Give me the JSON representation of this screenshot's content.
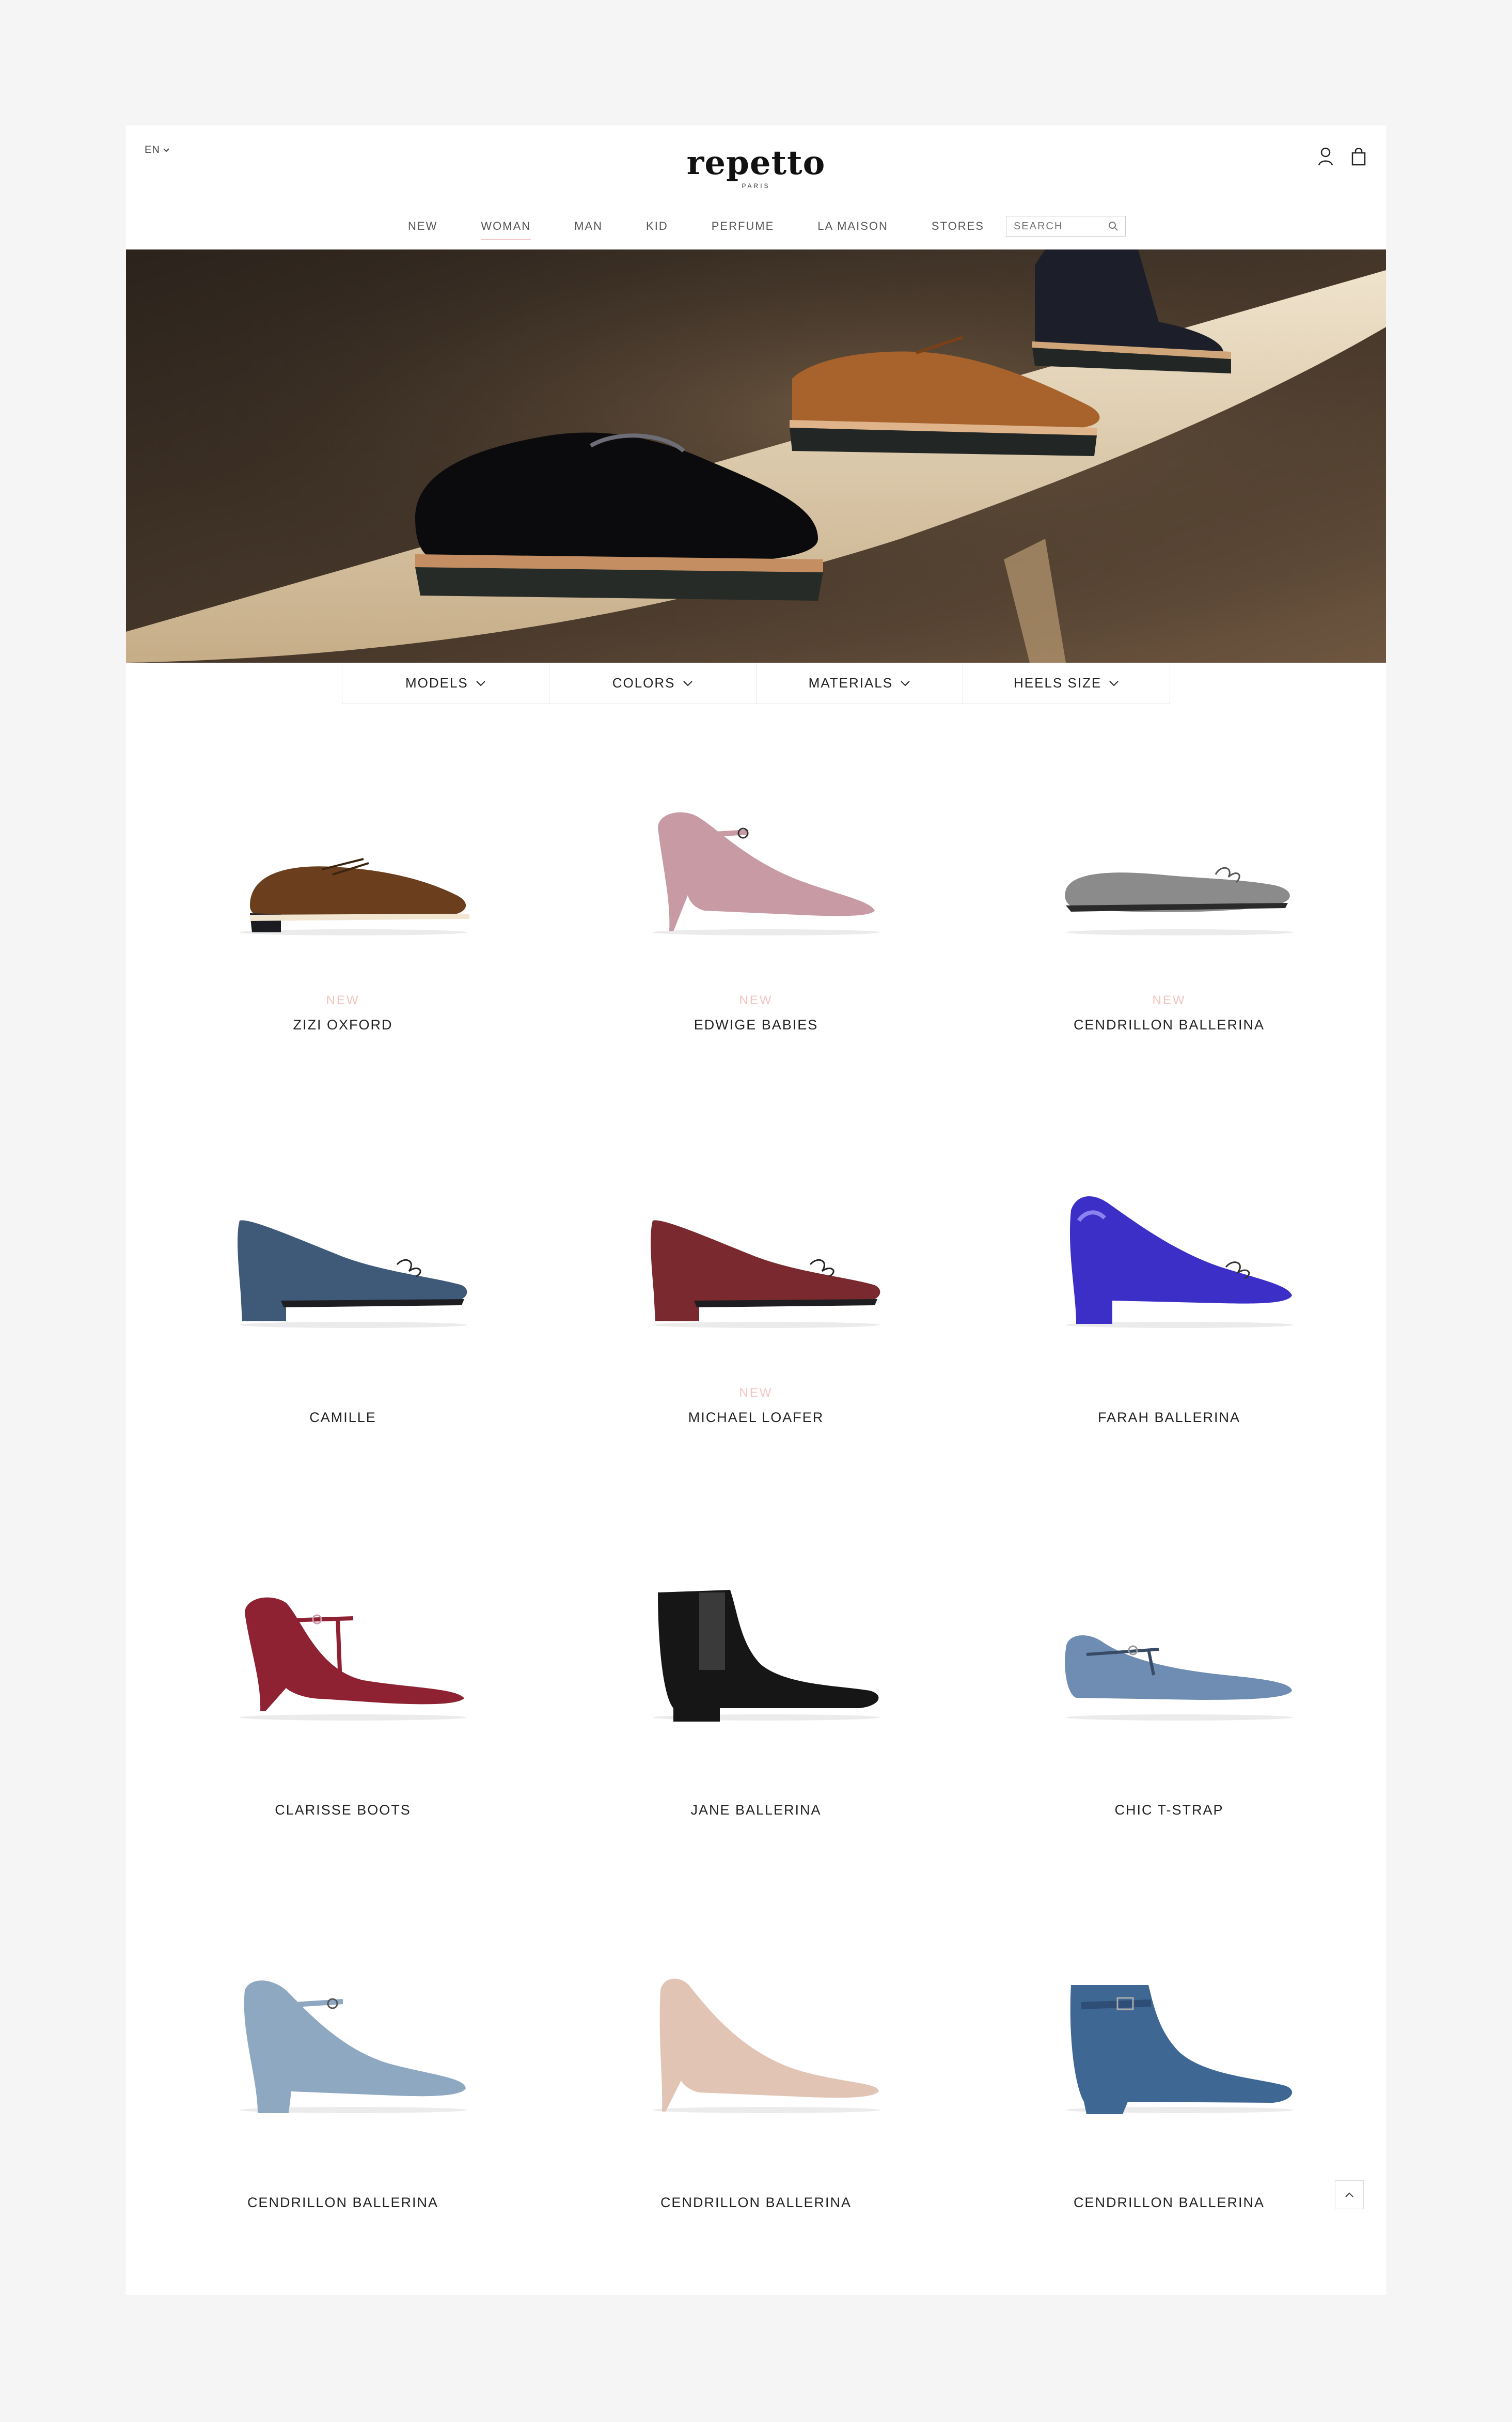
{
  "header": {
    "language": "EN",
    "logo_text": "repetto",
    "logo_subtext": "PARIS",
    "icons": [
      "user-icon",
      "shopping-bag-icon"
    ]
  },
  "nav": {
    "items": [
      "NEW",
      "WOMAN",
      "MAN",
      "KID",
      "PERFUME",
      "LA MAISON",
      "STORES"
    ],
    "active": "WOMAN",
    "search_placeholder": "SEARCH"
  },
  "filters": [
    "MODELS",
    "COLORS",
    "MATERIALS",
    "HEELS SIZE"
  ],
  "products": [
    {
      "name": "ZIZI OXFORD",
      "badge": "NEW",
      "color": "#6b3f1d",
      "style": "oxford"
    },
    {
      "name": "EDWIGE BABIES",
      "badge": "NEW",
      "color": "#c79aa4",
      "style": "maryjane-heel"
    },
    {
      "name": "CENDRILLON BALLERINA",
      "badge": "NEW",
      "color": "#8b8b8b",
      "style": "ballerina"
    },
    {
      "name": "CAMILLE",
      "badge": "",
      "color": "#3f5a78",
      "style": "low-heel"
    },
    {
      "name": "MICHAEL LOAFER",
      "badge": "NEW",
      "color": "#7a2a2e",
      "style": "low-heel"
    },
    {
      "name": "FARAH BALLERINA",
      "badge": "",
      "color": "#3b2fc7",
      "style": "block-heel"
    },
    {
      "name": "CLARISSE BOOTS",
      "badge": "",
      "color": "#8e2233",
      "style": "tstrap-heel"
    },
    {
      "name": "JANE BALLERINA",
      "badge": "",
      "color": "#161616",
      "style": "bootie"
    },
    {
      "name": "CHIC T-STRAP",
      "badge": "",
      "color": "#6f8db3",
      "style": "tstrap-flat"
    },
    {
      "name": "CENDRILLON BALLERINA",
      "badge": "",
      "color": "#8fa8c2",
      "style": "maryjane-block"
    },
    {
      "name": "CENDRILLON BALLERINA",
      "badge": "",
      "color": "#e1c4b4",
      "style": "stiletto"
    },
    {
      "name": "CENDRILLON BALLERINA",
      "badge": "",
      "color": "#3f6794",
      "style": "ankle-boot"
    }
  ]
}
